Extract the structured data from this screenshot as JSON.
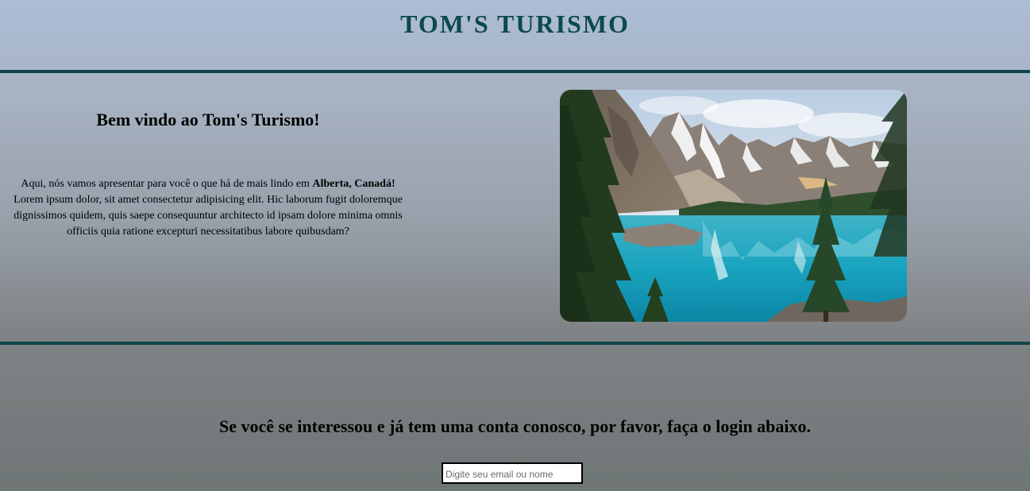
{
  "header": {
    "title": "TOM'S TURISMO"
  },
  "intro": {
    "heading": "Bem vindo ao Tom's Turismo!",
    "text_before": "Aqui, nós vamos apresentar para você o que há de mais lindo em ",
    "text_bold": "Alberta, Canadá!",
    "text_after": " Lorem ipsum dolor, sit amet consectetur adipisicing elit. Hic laborum fugit doloremque dignissimos quidem, quis saepe consequuntur architecto id ipsam dolore minima omnis officiis quia ratione excepturi necessitatibus labore quibusdam?"
  },
  "login": {
    "prompt": "Se você se interessou e já tem uma conta conosco, por favor, faça o login abaixo.",
    "input_value": "",
    "input_placeholder": "Digite seu email ou nome"
  },
  "colors": {
    "accent": "#0e4447",
    "title": "#0b4a4c"
  }
}
